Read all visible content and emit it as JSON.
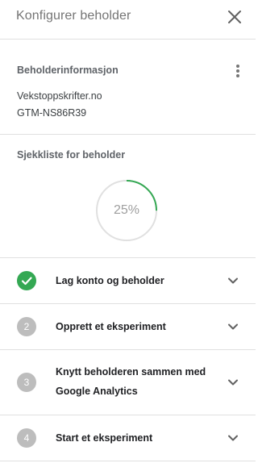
{
  "header": {
    "title": "Konfigurer beholder"
  },
  "container_info": {
    "title": "Beholderinformasjon",
    "name": "Vekstoppskrifter.no",
    "id": "GTM-NS86R39"
  },
  "checklist": {
    "title": "Sjekkliste for beholder",
    "progress_text": "25%",
    "progress_fraction": 0.25,
    "progress_color": "#34a853",
    "steps": [
      {
        "number": "",
        "status": "done",
        "label": "Lag konto og beholder"
      },
      {
        "number": "2",
        "status": "pending",
        "label": "Opprett et eksperiment"
      },
      {
        "number": "3",
        "status": "pending",
        "label_line1": "Knytt beholderen sammen med",
        "label_line2": "Google Analytics"
      },
      {
        "number": "4",
        "status": "pending",
        "label": "Start et eksperiment"
      }
    ]
  }
}
